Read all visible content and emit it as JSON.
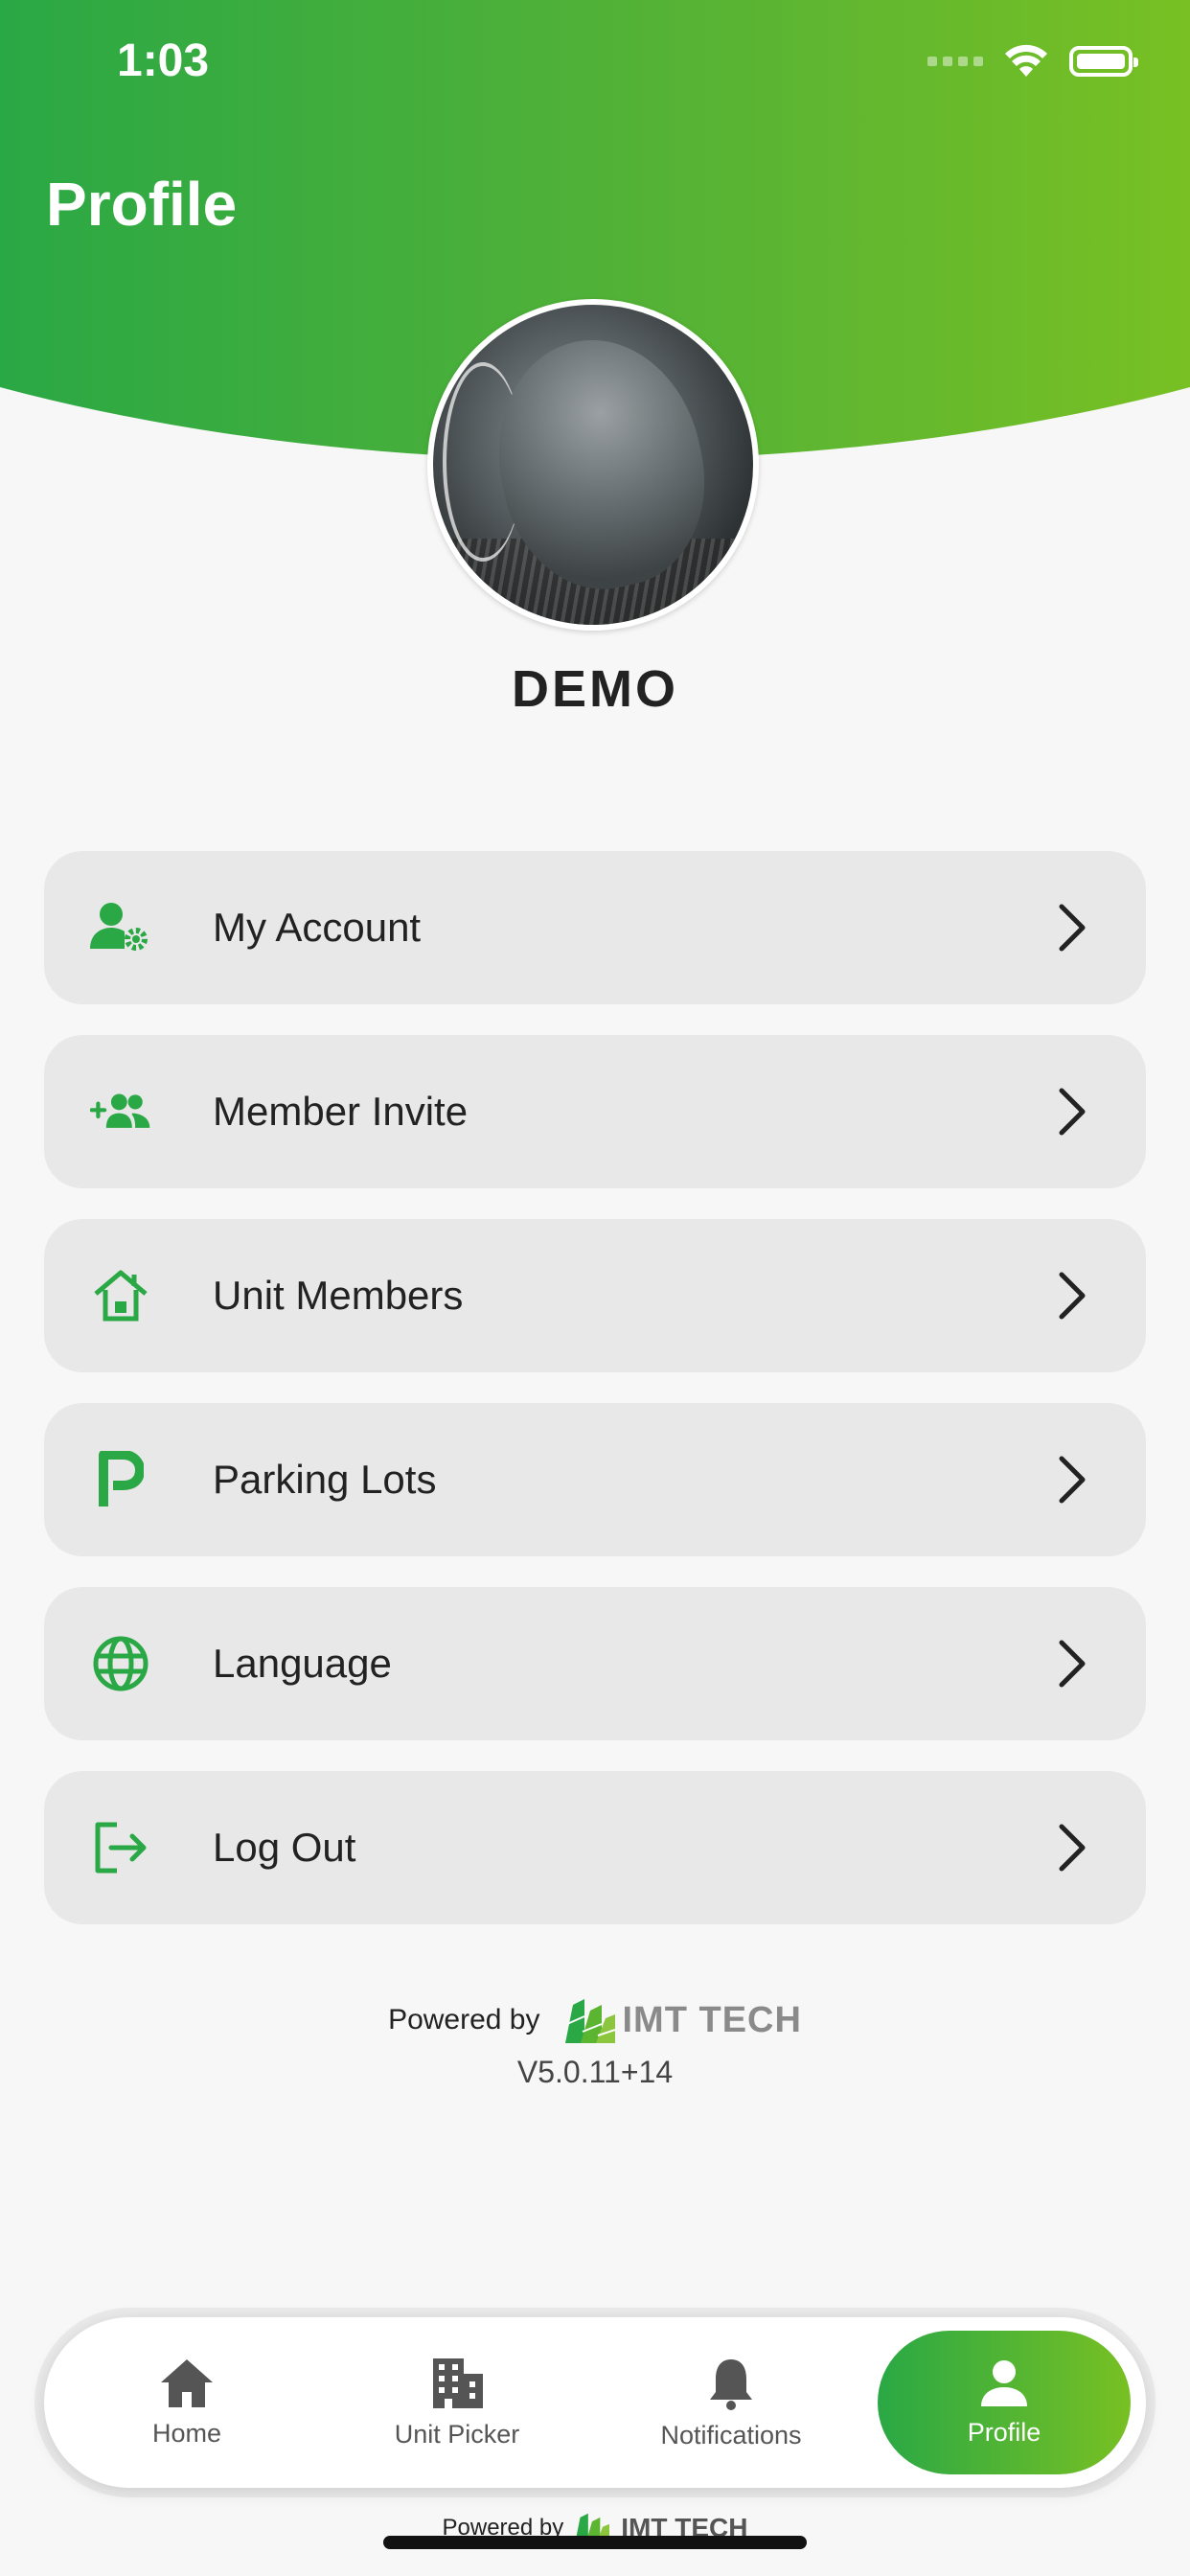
{
  "status_bar": {
    "time": "1:03"
  },
  "header": {
    "title": "Profile"
  },
  "profile": {
    "name": "DEMO"
  },
  "menu": {
    "items": [
      {
        "label": "My Account",
        "icon": "account-settings-icon"
      },
      {
        "label": "Member Invite",
        "icon": "add-group-icon"
      },
      {
        "label": "Unit Members",
        "icon": "house-icon"
      },
      {
        "label": "Parking Lots",
        "icon": "parking-icon"
      },
      {
        "label": "Language",
        "icon": "globe-icon"
      },
      {
        "label": "Log Out",
        "icon": "logout-icon"
      }
    ]
  },
  "footer": {
    "powered_by": "Powered by",
    "brand": "IMT TECH",
    "version": "V5.0.11+14"
  },
  "tabbar": {
    "tabs": [
      {
        "label": "Home",
        "icon": "home-icon"
      },
      {
        "label": "Unit Picker",
        "icon": "building-icon"
      },
      {
        "label": "Notifications",
        "icon": "bell-icon"
      },
      {
        "label": "Profile",
        "icon": "person-icon"
      }
    ],
    "active": "Profile"
  },
  "colors": {
    "accent": "#2aa845",
    "accent_end": "#78c023",
    "card_bg": "#e8e8e8"
  }
}
